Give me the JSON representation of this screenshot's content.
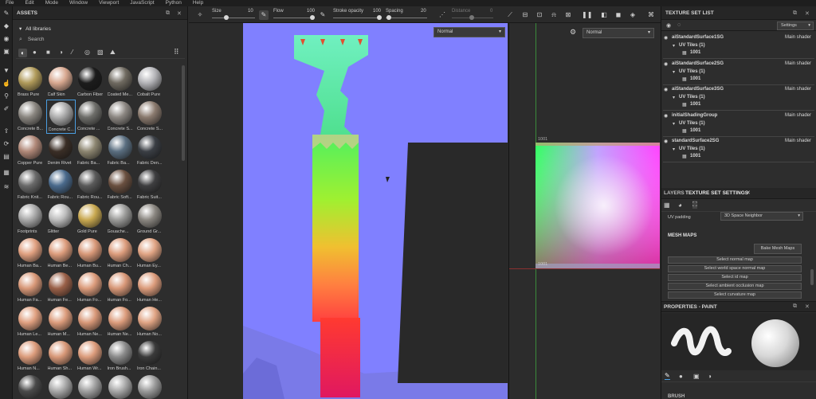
{
  "menu": [
    "File",
    "Edit",
    "Mode",
    "Window",
    "Viewport",
    "JavaScript",
    "Python",
    "Help"
  ],
  "assets": {
    "title": "ASSETS",
    "library": "All libraries",
    "search_placeholder": "Search",
    "materials": [
      {
        "label": "Brass Pure",
        "color": "#b09a5a"
      },
      {
        "label": "Calf Skin",
        "color": "#d8a890"
      },
      {
        "label": "Carbon Fiber",
        "color": "#1c1c1c"
      },
      {
        "label": "Coated Me...",
        "color": "#6f6a60"
      },
      {
        "label": "Cobalt Pure",
        "color": "#b4b4b8"
      },
      {
        "label": "Concrete B...",
        "color": "#8a8680"
      },
      {
        "label": "Concrete C...",
        "color": "#a8a8a8"
      },
      {
        "label": "Concrete ...",
        "color": "#6e6e6a"
      },
      {
        "label": "Concrete S...",
        "color": "#8c8782"
      },
      {
        "label": "Concrete S...",
        "color": "#8a7a6e"
      },
      {
        "label": "Copper Pure",
        "color": "#b08878"
      },
      {
        "label": "Denim Rivet",
        "color": "#3a2e26"
      },
      {
        "label": "Fabric Ba...",
        "color": "#8c8570"
      },
      {
        "label": "Fabric Ba...",
        "color": "#5a6e80"
      },
      {
        "label": "Fabric Den...",
        "color": "#3a3e44"
      },
      {
        "label": "Fabric Knit...",
        "color": "#6a6a6a"
      },
      {
        "label": "Fabric Rou...",
        "color": "#4a6a8c"
      },
      {
        "label": "Fabric Rou...",
        "color": "#5a5a5a"
      },
      {
        "label": "Fabric Soft...",
        "color": "#6a5040"
      },
      {
        "label": "Fabric Suit...",
        "color": "#3e3e40"
      },
      {
        "label": "Footprints",
        "color": "#a8a8a8"
      },
      {
        "label": "Glitter",
        "color": "#bcbcbc"
      },
      {
        "label": "Gold Pure",
        "color": "#c8a850"
      },
      {
        "label": "Gouache...",
        "color": "#9a9a98"
      },
      {
        "label": "Ground Gr...",
        "color": "#8a8680"
      },
      {
        "label": "Human Ba...",
        "color": "#e0a080"
      },
      {
        "label": "Human Be...",
        "color": "#dc9c7c"
      },
      {
        "label": "Human Bu...",
        "color": "#d89878"
      },
      {
        "label": "Human Ch...",
        "color": "#dc9c7c"
      },
      {
        "label": "Human Ey...",
        "color": "#e0a484"
      },
      {
        "label": "Human Fa...",
        "color": "#d89878"
      },
      {
        "label": "Human Fe...",
        "color": "#9a6048"
      },
      {
        "label": "Human Fo...",
        "color": "#dc9c7c"
      },
      {
        "label": "Human Fo...",
        "color": "#d89878"
      },
      {
        "label": "Human He...",
        "color": "#dc9c7c"
      },
      {
        "label": "Human Le...",
        "color": "#e0a080"
      },
      {
        "label": "Human M...",
        "color": "#dc9c7c"
      },
      {
        "label": "Human Ne...",
        "color": "#d89878"
      },
      {
        "label": "Human Ne...",
        "color": "#dc9c7c"
      },
      {
        "label": "Human No...",
        "color": "#e0a484"
      },
      {
        "label": "Human N...",
        "color": "#dc9c7c"
      },
      {
        "label": "Human Sh...",
        "color": "#d89878"
      },
      {
        "label": "Human Wr...",
        "color": "#dc9c7c"
      },
      {
        "label": "Iron Brush...",
        "color": "#8a8a8a"
      },
      {
        "label": "Iron Chain...",
        "color": "#3a3a3a"
      },
      {
        "label": "",
        "color": "#4a4a4a"
      },
      {
        "label": "",
        "color": "#a8a8a8"
      },
      {
        "label": "",
        "color": "#a0a0a0"
      },
      {
        "label": "",
        "color": "#a8a8a8"
      },
      {
        "label": "",
        "color": "#9a9a9a"
      }
    ]
  },
  "toolbar": {
    "size_label": "Size",
    "size_value": "10",
    "flow_label": "Flow",
    "flow_value": "100",
    "opacity_label": "Stroke opacity",
    "opacity_value": "100",
    "spacing_label": "Spacing",
    "spacing_value": "20",
    "distance_label": "Distance",
    "distance_value": "0"
  },
  "viewport": {
    "mode_3d": "Normal",
    "mode_2d": "Normal",
    "uv_top_label": "1001",
    "uv_bottom_label": "1001"
  },
  "texture_set_list": {
    "title": "TEXTURE SET LIST",
    "settings_label": "Settings",
    "sets": [
      {
        "name": "aiStandardSurface1SG",
        "shader": "Main shader",
        "uv": "UV Tiles (1)",
        "tile": "1001"
      },
      {
        "name": "aiStandardSurface2SG",
        "shader": "Main shader",
        "uv": "UV Tiles (1)",
        "tile": "1001"
      },
      {
        "name": "aiStandardSurface3SG",
        "shader": "Main shader",
        "uv": "UV Tiles (1)",
        "tile": "1001"
      },
      {
        "name": "initialShadingGroup",
        "shader": "Main shader",
        "uv": "UV Tiles (1)",
        "tile": "1001"
      },
      {
        "name": "standardSurface2SG",
        "shader": "Main shader",
        "uv": "UV Tiles (1)",
        "tile": "1001"
      }
    ]
  },
  "tabs": {
    "layers": "LAYERS",
    "texture_set_settings": "TEXTURE SET SETTINGS"
  },
  "tss": {
    "uv_padding_label": "UV padding",
    "uv_padding_value": "3D Space Neighbor",
    "mesh_maps_title": "MESH MAPS",
    "bake_button": "Bake Mesh Maps",
    "map_buttons": [
      "Select normal map",
      "Select world space normal map",
      "Select id map",
      "Select ambient occlusion map",
      "Select curvature map"
    ]
  },
  "properties": {
    "title": "PROPERTIES - PAINT",
    "brush_label": "BRUSH"
  },
  "colors": {
    "normal_blue": "#8080ff",
    "accent": "#4a9de0"
  }
}
